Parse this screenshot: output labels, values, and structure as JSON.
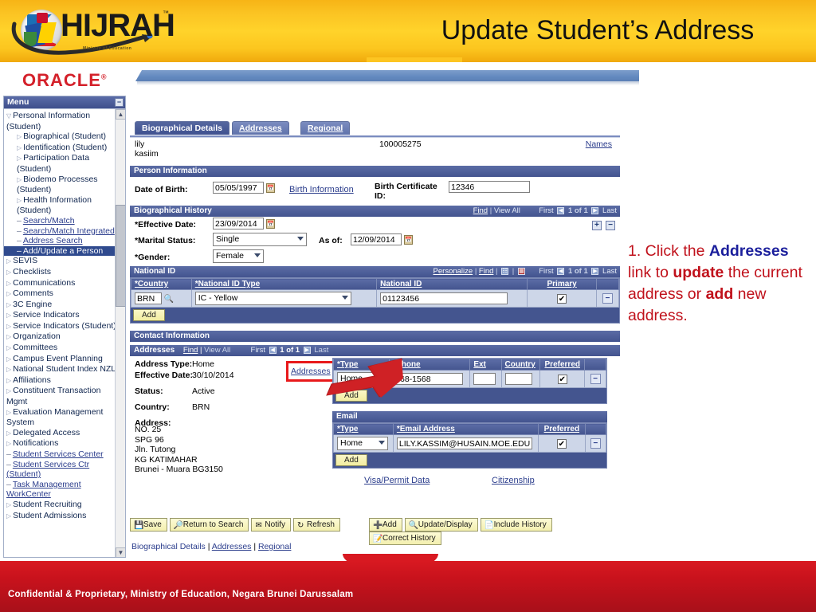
{
  "banner": {
    "logo_text": "HIJRAH",
    "logo_tm": "™",
    "logo_tagline": "Ministry of Education",
    "title": "Update Student’s Address"
  },
  "oracle": {
    "wordmark": "ORACLE",
    "registered": "®"
  },
  "menu": {
    "title": "Menu",
    "collapse_icon": "−",
    "scroll_up_icon": "▲",
    "scroll_down_icon": "▼",
    "items": [
      {
        "label": "Personal Information (Student)",
        "level": 0,
        "marker": "▽",
        "type": "folder-open"
      },
      {
        "label": "Biographical (Student)",
        "level": 1,
        "marker": "▷",
        "type": "folder"
      },
      {
        "label": "Identification (Student)",
        "level": 1,
        "marker": "▷",
        "type": "folder"
      },
      {
        "label": "Participation Data (Student)",
        "level": 1,
        "marker": "▷",
        "type": "folder"
      },
      {
        "label": "Biodemo Processes (Student)",
        "level": 1,
        "marker": "▷",
        "type": "folder"
      },
      {
        "label": "Health Information (Student)",
        "level": 1,
        "marker": "▷",
        "type": "folder"
      },
      {
        "label": "Search/Match",
        "level": 1,
        "marker": "–",
        "type": "link"
      },
      {
        "label": "Search/Match Integrated",
        "level": 1,
        "marker": "–",
        "type": "link"
      },
      {
        "label": "Address Search",
        "level": 1,
        "marker": "–",
        "type": "link"
      },
      {
        "label": "Add/Update a Person",
        "level": 1,
        "marker": "–",
        "type": "selected"
      },
      {
        "label": "SEVIS",
        "level": 0,
        "marker": "▷",
        "type": "folder"
      },
      {
        "label": "Checklists",
        "level": 0,
        "marker": "▷",
        "type": "folder"
      },
      {
        "label": "Communications",
        "level": 0,
        "marker": "▷",
        "type": "folder"
      },
      {
        "label": "Comments",
        "level": 0,
        "marker": "▷",
        "type": "folder"
      },
      {
        "label": "3C Engine",
        "level": 0,
        "marker": "▷",
        "type": "folder"
      },
      {
        "label": "Service Indicators",
        "level": 0,
        "marker": "▷",
        "type": "folder"
      },
      {
        "label": "Service Indicators (Student)",
        "level": 0,
        "marker": "▷",
        "type": "folder"
      },
      {
        "label": "Organization",
        "level": 0,
        "marker": "▷",
        "type": "folder"
      },
      {
        "label": "Committees",
        "level": 0,
        "marker": "▷",
        "type": "folder"
      },
      {
        "label": "Campus Event Planning",
        "level": 0,
        "marker": "▷",
        "type": "folder"
      },
      {
        "label": "National Student Index NZL",
        "level": 0,
        "marker": "▷",
        "type": "folder"
      },
      {
        "label": "Affiliations",
        "level": 0,
        "marker": "▷",
        "type": "folder"
      },
      {
        "label": "Constituent Transaction Mgmt",
        "level": 0,
        "marker": "▷",
        "type": "folder"
      },
      {
        "label": "Evaluation Management System",
        "level": 0,
        "marker": "▷",
        "type": "folder"
      },
      {
        "label": "Delegated Access",
        "level": 0,
        "marker": "▷",
        "type": "folder"
      },
      {
        "label": "Notifications",
        "level": 0,
        "marker": "▷",
        "type": "folder"
      },
      {
        "label": "Student Services Center",
        "level": 0,
        "marker": "–",
        "type": "link"
      },
      {
        "label": "Student Services Ctr (Student)",
        "level": 0,
        "marker": "–",
        "type": "link"
      },
      {
        "label": "Task Management WorkCenter",
        "level": 0,
        "marker": "–",
        "type": "link"
      },
      {
        "label": "Student Recruiting",
        "level": 0,
        "marker": "▷",
        "type": "folder"
      },
      {
        "label": "Student Admissions",
        "level": 0,
        "marker": "▷",
        "type": "folder"
      }
    ]
  },
  "page": {
    "tabs": [
      {
        "label": "Biographical Details",
        "active": true
      },
      {
        "label": "Addresses",
        "active": false
      },
      {
        "label": "Regional",
        "active": false
      }
    ],
    "person": {
      "first_name": "lily",
      "last_name": "kasiim",
      "id": "100005275",
      "names_link": "Names"
    },
    "person_information": {
      "title": "Person Information",
      "date_of_birth_label": "Date of Birth:",
      "date_of_birth": "05/05/1997",
      "birth_information_link": "Birth Information",
      "birth_certificate_label": "Birth Certificate ID:",
      "birth_certificate_id": "12346"
    },
    "biographical_history": {
      "title": "Biographical History",
      "find": "Find",
      "view_all": "View All",
      "first": "First",
      "counter": "1 of 1",
      "last": "Last",
      "effective_date_label": "*Effective Date:",
      "effective_date": "23/09/2014",
      "marital_status_label": "*Marital Status:",
      "marital_status": "Single",
      "as_of_label": "As of:",
      "as_of": "12/09/2014",
      "gender_label": "*Gender:",
      "gender": "Female",
      "add_row_icon": "+",
      "delete_row_icon": "−"
    },
    "national_id": {
      "title": "National ID",
      "personalize": "Personalize",
      "find": "Find",
      "first": "First",
      "counter": "1 of 1",
      "last": "Last",
      "columns": [
        "*Country",
        "*National ID Type",
        "National ID",
        "Primary",
        ""
      ],
      "rows": [
        {
          "country": "BRN",
          "type": "IC - Yellow",
          "national_id": "01123456",
          "primary": true,
          "delete_icon": "−"
        }
      ],
      "add_button": "Add"
    },
    "contact_information": {
      "title": "Contact Information"
    },
    "addresses": {
      "title": "Addresses",
      "find": "Find",
      "view_all": "View All",
      "first": "First",
      "counter": "1 of 1",
      "last": "Last",
      "address_type_label": "Address Type:",
      "address_type": "Home",
      "effective_date_label": "Effective Date:",
      "effective_date": "30/10/2014",
      "status_label": "Status:",
      "status": "Active",
      "country_label": "Country:",
      "country": "BRN",
      "address_label": "Address:",
      "address_lines": [
        "NO. 25",
        "SPG 96",
        "Jln. Tutong",
        "KG KATIMAHAR",
        "Brunei - Muara BG3150"
      ],
      "addresses_link": "Addresses"
    },
    "phone": {
      "columns": [
        "*Type",
        "*Phone",
        "Ext",
        "Country",
        "Preferred",
        ""
      ],
      "rows": [
        {
          "type": "Home",
          "phone": "268-1568",
          "ext": "",
          "country": "",
          "preferred": true,
          "delete_icon": "−"
        }
      ],
      "add_button": "Add"
    },
    "email": {
      "title": "Email",
      "columns": [
        "*Type",
        "*Email Address",
        "Preferred",
        ""
      ],
      "rows": [
        {
          "type": "Home",
          "email": "LILY.KASSIM@HUSAIN.MOE.EDU.B",
          "preferred": true,
          "delete_icon": "−"
        }
      ],
      "add_button": "Add"
    },
    "links": {
      "visa_permit": "Visa/Permit Data",
      "citizenship": "Citizenship"
    },
    "toolbar_left": [
      {
        "label": "Save",
        "icon": "save-icon"
      },
      {
        "label": "Return to Search",
        "icon": "return-icon"
      },
      {
        "label": "Notify",
        "icon": "notify-icon"
      },
      {
        "label": "Refresh",
        "icon": "refresh-icon"
      }
    ],
    "toolbar_right": [
      {
        "label": "Add",
        "icon": "add-icon"
      },
      {
        "label": "Update/Display",
        "icon": "update-icon"
      },
      {
        "label": "Include History",
        "icon": "history-icon"
      },
      {
        "label": "Correct History",
        "icon": "correct-icon"
      }
    ],
    "bottom_links": [
      "Biographical Details",
      "Addresses",
      "Regional"
    ],
    "bottom_link_separator": " | "
  },
  "annotation": {
    "step": "1. Click the ",
    "link_word": "Addresses",
    "mid1": " link to ",
    "bold1": "update",
    "mid2": " the current address or ",
    "bold2": "add",
    "end": " new address."
  },
  "footer": {
    "text": "Confidential & Proprietary, Ministry of Education, Negara Brunei Darussalam"
  },
  "colors": {
    "banner_gold": "#ffd32a",
    "oracle_red": "#d4202a",
    "ps_header_blue": "#49599a",
    "ps_grid_row": "#cdd6e8",
    "highlight_red": "#e8191b",
    "annotation_red": "#c0111b",
    "annotation_blue": "#1b1f9c",
    "footer_red": "#c8121c",
    "menu_selected": "#2f4a8e"
  }
}
